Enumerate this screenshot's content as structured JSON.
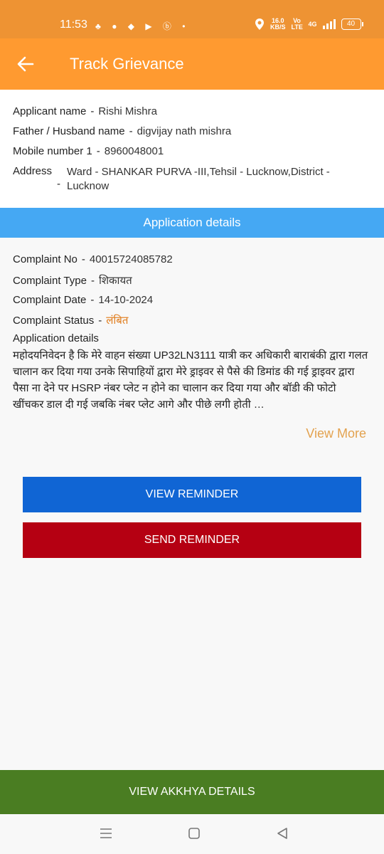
{
  "status_bar": {
    "time": "11:53",
    "notif_icons": "♣ ● ◆ ▶ ⓑ •",
    "speed_value": "16.0",
    "speed_unit": "KB/S",
    "volte": "Vo LTE",
    "network": "4G",
    "battery": "40"
  },
  "header": {
    "title": "Track Grievance"
  },
  "applicant": {
    "name_label": "Applicant name",
    "name_value": "Rishi Mishra",
    "father_label": "Father / Husband name",
    "father_value": "digvijay nath mishra",
    "mobile_label": "Mobile number 1",
    "mobile_value": "8960048001",
    "address_label": "Address",
    "address_value": "Ward - SHANKAR PURVA -III,Tehsil - Lucknow,District - Lucknow",
    "separator": "-"
  },
  "section_title": "Application details",
  "details": {
    "complaint_no_label": "Complaint No",
    "complaint_no_value": "40015724085782",
    "complaint_type_label": "Complaint Type",
    "complaint_type_value": "शिकायत",
    "complaint_date_label": "Complaint Date",
    "complaint_date_value": "14-10-2024",
    "complaint_status_label": "Complaint Status",
    "complaint_status_value": "लंबित",
    "application_details_label": "Application details",
    "application_details_text": "महोदयनिवेदन है कि मेरे वाहन संख्या UP32LN3111 यात्री कर अधिकारी बाराबंकी द्वारा गलत चालान कर दिया गया उनके सिपाहियों द्वारा मेरे ड्राइवर से पैसे की डिमांड की गई ड्राइवर द्वारा पैसा ना देने पर HSRP नंबर प्लेट न होने का चालान कर दिया गया और बॉडी की फोटो खींचकर डाल दी गई जबकि नंबर प्लेट आगे और पीछे लगी होती …",
    "view_more": "View More"
  },
  "buttons": {
    "view_reminder": "VIEW REMINDER",
    "send_reminder": "SEND REMINDER",
    "view_akkhya": "VIEW AKKHYA DETAILS"
  },
  "colors": {
    "status_bar": "#ee9333",
    "app_bar": "#ff9a30",
    "section_header": "#45a8f3",
    "view_reminder": "#1065d4",
    "send_reminder": "#b50012",
    "footer": "#4a7d22",
    "status_text": "#e07b1a"
  }
}
